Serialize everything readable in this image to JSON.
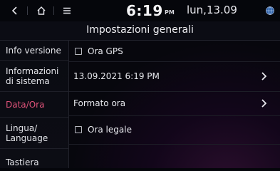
{
  "statusbar": {
    "time": "6:19",
    "ampm": "PM",
    "date": "lun,13.09",
    "icons": [
      "back-icon",
      "home-icon",
      "menu-icon",
      "globe-icon"
    ]
  },
  "header": {
    "title": "Impostazioni generali"
  },
  "sidebar": {
    "items": [
      {
        "label": "Info versione"
      },
      {
        "label": "Informazioni di sistema"
      },
      {
        "label": "Data/Ora",
        "active": true
      },
      {
        "label": "Lingua/ Language"
      },
      {
        "label": "Tastiera"
      }
    ]
  },
  "main": {
    "rows": [
      {
        "label": "Ora GPS",
        "checked": false
      },
      {
        "label": "13.09.2021 6:19  PM"
      },
      {
        "label": "Formato ora"
      },
      {
        "label": "Ora legale",
        "checked": false
      }
    ]
  },
  "colors": {
    "active": "#e0537a",
    "background": "#05060b"
  }
}
